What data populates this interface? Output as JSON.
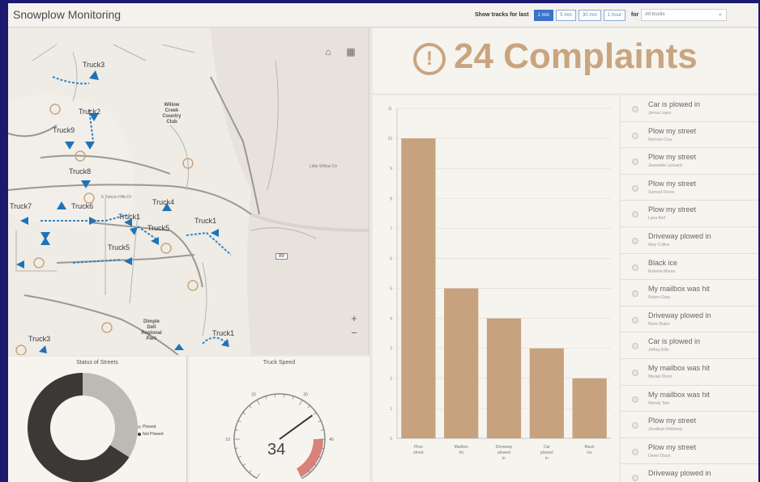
{
  "header": {
    "app_title": "Snowplow Monitoring",
    "tracks_label": "Show tracks for last",
    "time_options": [
      "1 min",
      "5 min",
      "30 min",
      "1 hour"
    ],
    "active_time": "1 min",
    "for_label": "for",
    "truck_select": "All trucks"
  },
  "map": {
    "truck_labels": [
      {
        "text": "Truck3"
      },
      {
        "text": "Truck2"
      },
      {
        "text": "Truck9"
      },
      {
        "text": "Truck8"
      },
      {
        "text": "Truck4"
      },
      {
        "text": "Truck7"
      },
      {
        "text": "Truck6"
      },
      {
        "text": "Truck1"
      },
      {
        "text": "Truck5"
      },
      {
        "text": "Truck1"
      },
      {
        "text": "Truck5"
      },
      {
        "text": "Truck1"
      },
      {
        "text": "Truck3"
      }
    ],
    "places": {
      "willow_creek": "Willow\nCreek\nCountry\nClub",
      "dimple_dell": "Dimple\nDell\nRegional\nPark"
    },
    "highway": "89",
    "streets": [
      "Little Willow Cir",
      "E Falcon Hills Dr"
    ]
  },
  "donut": {
    "title": "Status of Streets",
    "legend": [
      {
        "label": "Plowed",
        "color": "#bdbab6"
      },
      {
        "label": "Not Plowed",
        "color": "#3b3836"
      }
    ],
    "share_plowed": 0.34
  },
  "gauge": {
    "title": "Truck Speed",
    "value": "34",
    "min": 0,
    "max": 50,
    "ticks": [
      "0",
      "10",
      "20",
      "30",
      "40",
      "50"
    ]
  },
  "complaints": {
    "icon": "!",
    "text": "24 Complaints"
  },
  "chart_data": {
    "type": "bar",
    "categories": [
      "Plow street",
      "Mailbox hit",
      "Driveway plowed in",
      "Car plowed in",
      "Black ice"
    ],
    "values": [
      10,
      5,
      4,
      3,
      2
    ],
    "ylim": [
      0,
      11
    ],
    "yticks": [
      "0",
      "1",
      "2",
      "3",
      "4",
      "5",
      "6",
      "7",
      "8",
      "9",
      "10",
      "11"
    ],
    "bar_color": "#c7a27e",
    "grid": true
  },
  "complaint_list": [
    {
      "title": "Car is plowed in",
      "sub": "Jenna Lopez"
    },
    {
      "title": "Plow my street",
      "sub": "Norman Cruz"
    },
    {
      "title": "Plow my street",
      "sub": "Jeannette Leonard"
    },
    {
      "title": "Plow my street",
      "sub": "Samuel Flores"
    },
    {
      "title": "Plow my street",
      "sub": "Lana Bell"
    },
    {
      "title": "Driveway plowed in",
      "sub": "Amy Collins"
    },
    {
      "title": "Black ice",
      "sub": "Roberta Moore"
    },
    {
      "title": "My mailbox was hit",
      "sub": "Ruben Gray"
    },
    {
      "title": "Driveway plowed in",
      "sub": "Norm Baker"
    },
    {
      "title": "Car is plowed in",
      "sub": "Jeffrey Ellis"
    },
    {
      "title": "My mailbox was hit",
      "sub": "Marian Dixon"
    },
    {
      "title": "My mailbox was hit",
      "sub": "Wendy Tate"
    },
    {
      "title": "Plow my street",
      "sub": "Jonathan Holloway"
    },
    {
      "title": "Plow my street",
      "sub": "Owen Olson"
    },
    {
      "title": "Driveway plowed in",
      "sub": ""
    }
  ]
}
